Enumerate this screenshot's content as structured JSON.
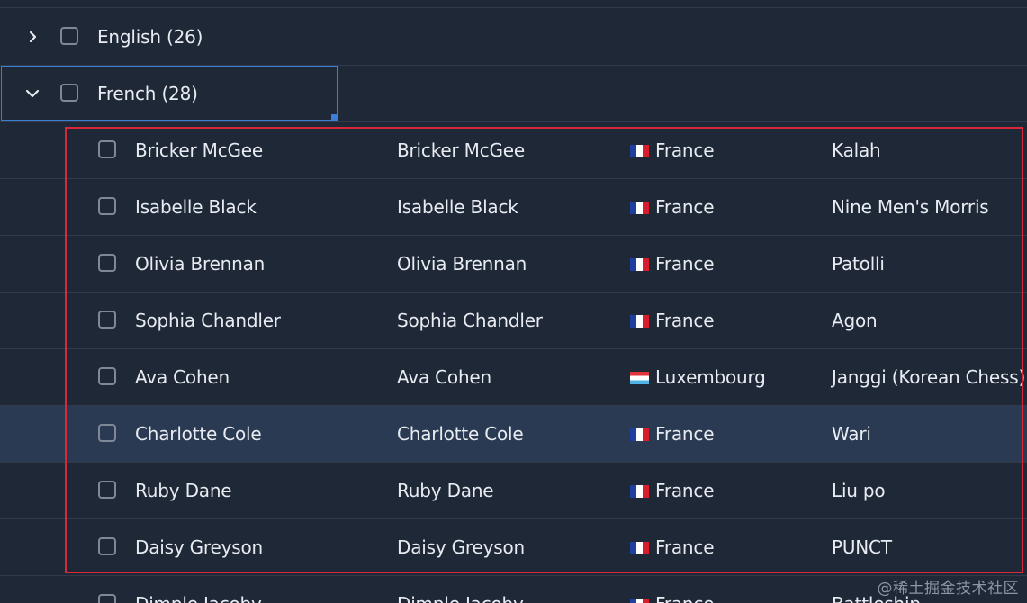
{
  "groups": [
    {
      "label": "English (26)",
      "expanded": false
    },
    {
      "label": "French (28)",
      "expanded": true
    }
  ],
  "rows": [
    {
      "name": "Bricker McGee",
      "name2": "Bricker McGee",
      "country": "France",
      "flag": "france-flag-icon",
      "game": "Kalah"
    },
    {
      "name": "Isabelle Black",
      "name2": "Isabelle Black",
      "country": "France",
      "flag": "france-flag-icon",
      "game": "Nine Men's Morris"
    },
    {
      "name": "Olivia Brennan",
      "name2": "Olivia Brennan",
      "country": "France",
      "flag": "france-flag-icon",
      "game": "Patolli"
    },
    {
      "name": "Sophia Chandler",
      "name2": "Sophia Chandler",
      "country": "France",
      "flag": "france-flag-icon",
      "game": "Agon"
    },
    {
      "name": "Ava Cohen",
      "name2": "Ava Cohen",
      "country": "Luxembourg",
      "flag": "luxembourg-flag-icon",
      "game": "Janggi (Korean Chess)"
    },
    {
      "name": "Charlotte Cole",
      "name2": "Charlotte Cole",
      "country": "France",
      "flag": "france-flag-icon",
      "game": "Wari"
    },
    {
      "name": "Ruby Dane",
      "name2": "Ruby Dane",
      "country": "France",
      "flag": "france-flag-icon",
      "game": "Liu po"
    },
    {
      "name": "Daisy Greyson",
      "name2": "Daisy Greyson",
      "country": "France",
      "flag": "france-flag-icon",
      "game": "PUNCT"
    },
    {
      "name": "Dimple Jacoby",
      "name2": "Dimple Jacoby",
      "country": "France",
      "flag": "france-flag-icon",
      "game": "Battleship"
    }
  ],
  "selected_row": "Charlotte Cole",
  "watermark": "@稀土掘金技术社区",
  "colors": {
    "background": "#1f2836",
    "selected_row": "#2a3a52",
    "focus_border": "#3a7fd5",
    "highlight_border": "#d8283a"
  }
}
